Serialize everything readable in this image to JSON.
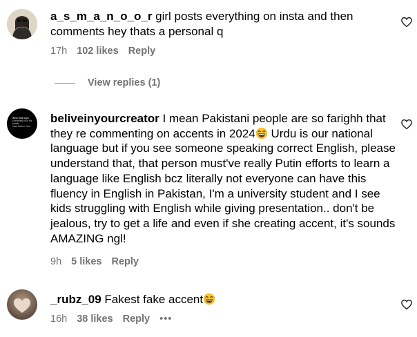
{
  "comments": [
    {
      "username": "a_s_m_a_n_o_o_r",
      "text": " girl posts everything on insta and then comments hey thats a personal q",
      "time": "17h",
      "likes": "102 likes",
      "reply": "Reply"
    },
    {
      "username": "beliveinyourcreator",
      "text_before_emoji": " I mean Pakistani people are so farighh that they re commenting on accents in 2024",
      "text_after_emoji": " Urdu is our national language but if you see someone speaking correct English, please understand that, that person must've really Putin efforts to learn a language like English bcz literally not everyone can have this fluency in English in Pakistan, I'm a university student and I see kids struggling with English while giving presentation.. don't be jealous, try to get a life and even if she creating accent, it's sounds AMAZING ngl!",
      "time": "9h",
      "likes": "5 likes",
      "reply": "Reply",
      "avatar_text": [
        "Wise bird says",
        "Everything is in his hands",
        "have faith in God"
      ]
    },
    {
      "username": "_rubz_09",
      "text": " Fakest fake accent",
      "time": "16h",
      "likes": "38 likes",
      "reply": "Reply",
      "more": "•••"
    }
  ],
  "view_replies": "View replies (1)",
  "emoji": "laughing-emoji",
  "colors": {
    "secondary_text": "#737373",
    "text": "#000000",
    "emoji": "#f7c22d"
  }
}
